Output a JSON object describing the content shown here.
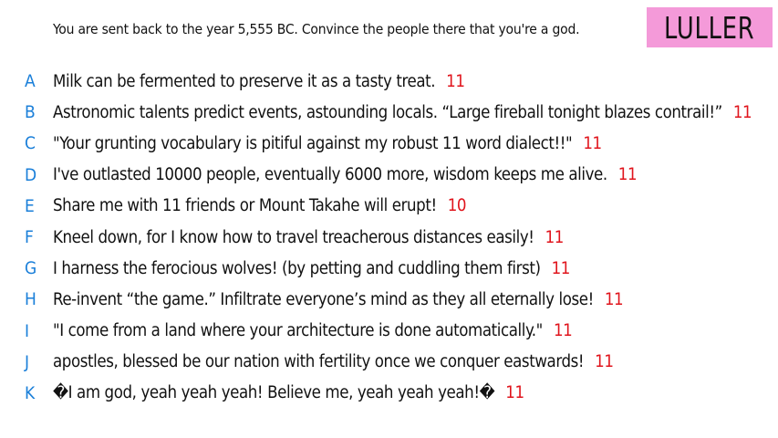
{
  "prompt": "You are sent back to the year 5,555 BC. Convince the people there that you're a god.",
  "logo": "LULLER",
  "colors": {
    "letter": "#1a7fd9",
    "score": "#e0141c",
    "logo_bg": "#f49ad9"
  },
  "answers": [
    {
      "letter": "A",
      "text": "Milk can be fermented to preserve it as a tasty treat.",
      "score": "11"
    },
    {
      "letter": "B",
      "text": "Astronomic talents predict events, astounding locals. “Large fireball tonight blazes contrail!”",
      "score": "11"
    },
    {
      "letter": "C",
      "text": "\"Your grunting vocabulary is pitiful against my robust 11 word dialect!!\"",
      "score": "11"
    },
    {
      "letter": "D",
      "text": "I've outlasted 10000 people, eventually 6000 more, wisdom keeps me alive.",
      "score": "11"
    },
    {
      "letter": "E",
      "text": "Share me with 11 friends or Mount Takahe will erupt!",
      "score": "10"
    },
    {
      "letter": "F",
      "text": "Kneel down, for I know how to travel treacherous distances easily!",
      "score": "11"
    },
    {
      "letter": "G",
      "text": "I harness the ferocious wolves! (by petting and cuddling them first)",
      "score": "11"
    },
    {
      "letter": "H",
      "text": "Re-invent “the game.” Infiltrate everyone’s mind as they all eternally lose!",
      "score": "11"
    },
    {
      "letter": "I",
      "text": "\"I come from a land where your architecture is done automatically.\"",
      "score": "11"
    },
    {
      "letter": "J",
      "text": "apostles, blessed be our nation with fertility once we conquer eastwards!",
      "score": "11"
    },
    {
      "letter": "K",
      "text": "�I am god, yeah yeah yeah! Believe me, yeah yeah yeah!�",
      "score": "11"
    }
  ]
}
